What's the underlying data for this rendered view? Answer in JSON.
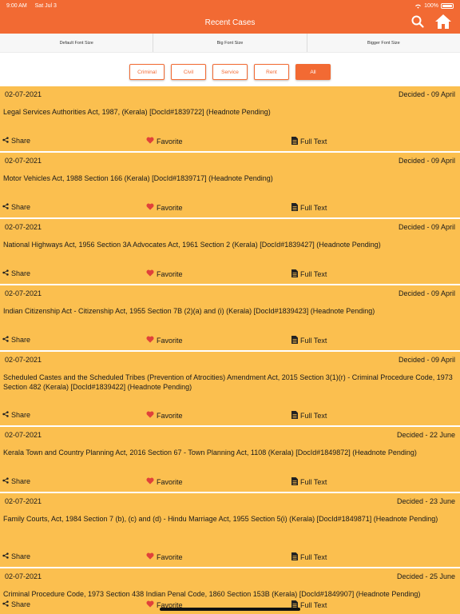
{
  "status_bar": {
    "time": "9:00 AM",
    "date": "Sat Jul 3",
    "battery": "100%"
  },
  "header": {
    "title": "Recent Cases",
    "icons": [
      "search-icon",
      "home-icon"
    ]
  },
  "font_options": [
    "Default Font Size",
    "Big Font Size",
    "Bigger Font Size"
  ],
  "filters": [
    "Criminal",
    "Civil",
    "Service",
    "Rent",
    "All"
  ],
  "active_filter": "All",
  "colors": {
    "accent": "#f26a33",
    "card_bg": "#fbbf4f",
    "heart": "#e0413a"
  },
  "actions": {
    "share": "Share",
    "favorite": "Favorite",
    "full_text": "Full Text"
  },
  "cases": [
    {
      "date": "02-07-2021",
      "decided": "Decided - 09 April",
      "subject": "Legal Services Authorities Act, 1987, (Kerala) [DocId#1839722] (Headnote Pending)"
    },
    {
      "date": "02-07-2021",
      "decided": "Decided - 09 April",
      "subject": "Motor Vehicles Act, 1988 Section 166 (Kerala) [DocId#1839717] (Headnote Pending)"
    },
    {
      "date": "02-07-2021",
      "decided": "Decided - 09 April",
      "subject": "National Highways Act, 1956 Section 3A Advocates Act, 1961 Section 2 (Kerala) [DocId#1839427] (Headnote Pending)"
    },
    {
      "date": "02-07-2021",
      "decided": "Decided - 09 April",
      "subject": "Indian Citizenship Act - Citizenship Act, 1955 Section 7B (2)(a) and (i) (Kerala) [DocId#1839423] (Headnote Pending)"
    },
    {
      "date": "02-07-2021",
      "decided": "Decided - 09 April",
      "subject": "Scheduled Castes and the Scheduled Tribes (Prevention of Atrocities) Amendment Act, 2015 Section 3(1)(r) - Criminal Procedure Code, 1973 Section 482 (Kerala) [DocId#1839422] (Headnote Pending)"
    },
    {
      "date": "02-07-2021",
      "decided": "Decided - 22 June",
      "subject": "Kerala Town and Country Planning Act, 2016 Section 67 - Town Planning Act, 1108 (Kerala) [DocId#1849872] (Headnote Pending)"
    },
    {
      "date": "02-07-2021",
      "decided": "Decided - 23 June",
      "subject": "Family Courts, Act, 1984 Section 7 (b), (c) and (d) - Hindu Marriage Act, 1955 Section 5(i) (Kerala) [DocId#1849871] (Headnote Pending)"
    },
    {
      "date": "02-07-2021",
      "decided": "Decided - 25 June",
      "subject": "Criminal Procedure Code, 1973 Section 438 Indian Penal Code, 1860 Section 153B (Kerala) [DocId#1849907] (Headnote Pending)"
    }
  ]
}
